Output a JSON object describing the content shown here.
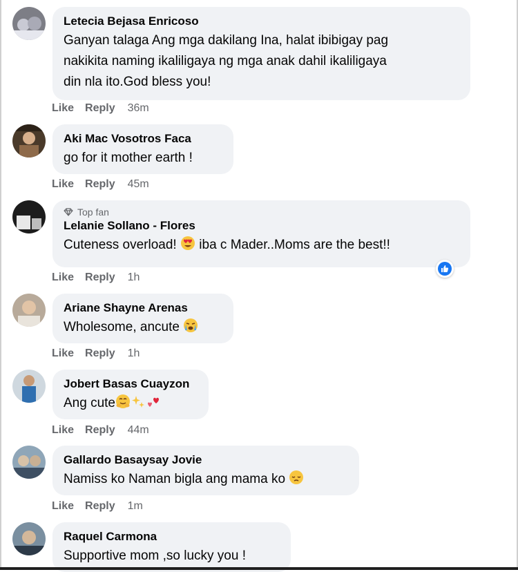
{
  "actions": {
    "like": "Like",
    "reply": "Reply"
  },
  "comments": [
    {
      "author": "Letecia Bejasa Enricoso",
      "text_lines": [
        "Ganyan talaga Ang mga dakilang Ina, halat ibibigay pag",
        "nakikita naming ikaliligaya ng mga anak dahil ikaliligaya",
        "din nla ito.God bless you!"
      ],
      "time": "36m"
    },
    {
      "author": "Aki Mac Vosotros Faca",
      "text": "go for it mother earth !",
      "time": "45m"
    },
    {
      "badge": "Top fan",
      "author": "Lelanie Sollano - Flores",
      "text_before": "Cuteness overload!",
      "text_after": "iba c Mader..Moms are the best!!",
      "time": "1h"
    },
    {
      "author": "Ariane Shayne Arenas",
      "text": "Wholesome, ancute",
      "time": "1h"
    },
    {
      "author": "Jobert Basas Cuayzon",
      "text": "Ang cute",
      "time": "44m"
    },
    {
      "author": "Gallardo Basaysay Jovie",
      "text": "Namiss ko Naman bigla ang mama ko",
      "time": "1m"
    },
    {
      "author": "Raquel Carmona",
      "text": "Supportive mom ,so lucky you !"
    }
  ]
}
